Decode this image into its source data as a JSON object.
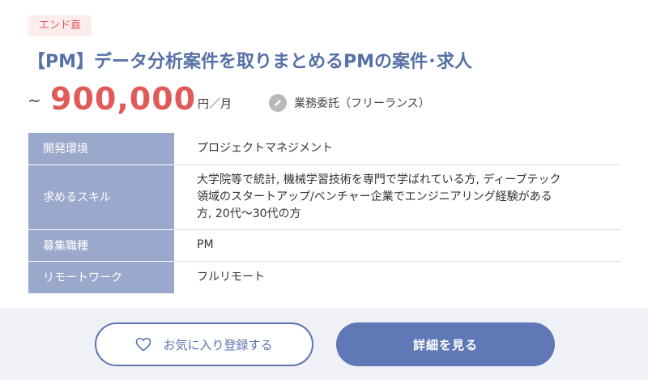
{
  "badge": "エンド直",
  "title": "【PM】データ分析案件を取りまとめるPMの案件･求人",
  "price": {
    "prefix": "~",
    "amount": "900,000",
    "unit": "円／月"
  },
  "contract": {
    "icon": "pen-icon",
    "label": "業務委託（フリーランス）"
  },
  "details": [
    {
      "label": "開発環境",
      "value": "プロジェクトマネジメント"
    },
    {
      "label": "求めるスキル",
      "value_lines": [
        "大学院等で統計, 機械学習技術を専門で学ばれている方, ディープテック",
        "領域のスタートアップ/ベンチャー企業でエンジニアリング経験がある",
        "方, 20代～30代の方"
      ]
    },
    {
      "label": "募集職種",
      "value": "PM"
    },
    {
      "label": "リモートワーク",
      "value": "フルリモート"
    }
  ],
  "actions": {
    "favorite_label": "お気に入り登録する",
    "favorite_icon": "heart-icon",
    "detail_label": "詳細を見る"
  },
  "colors": {
    "accent": "#5f78b6",
    "price": "#e05a5a",
    "table_header": "#9aa8cc"
  }
}
